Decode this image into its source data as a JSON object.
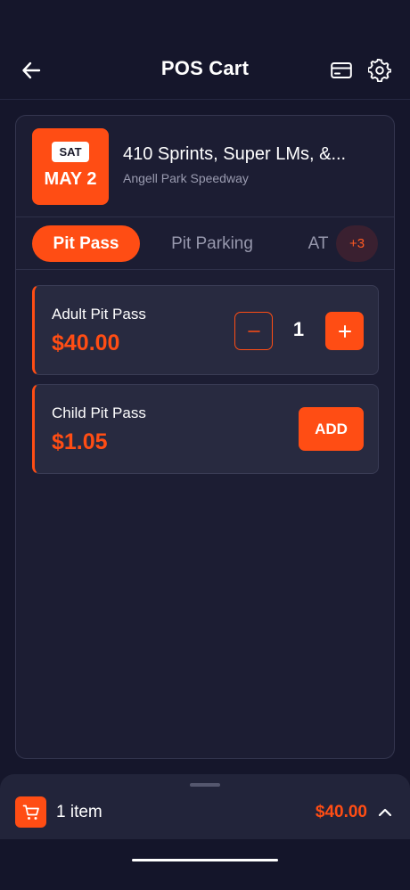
{
  "header": {
    "title": "POS Cart",
    "back_icon": "arrow-left-icon",
    "card_icon": "credit-card-icon",
    "settings_icon": "gear-icon"
  },
  "event": {
    "day": "SAT",
    "date": "MAY 2",
    "title": "410 Sprints, Super LMs, &...",
    "venue": "Angell Park Speedway"
  },
  "tabs": {
    "items": [
      {
        "label": "Pit Pass",
        "active": true
      },
      {
        "label": "Pit Parking",
        "active": false
      },
      {
        "label": "AT",
        "active": false
      }
    ],
    "more_label": "+3"
  },
  "tickets": [
    {
      "name": "Adult Pit Pass",
      "price": "$40.00",
      "quantity": "1"
    },
    {
      "name": "Child Pit Pass",
      "price": "$1.05",
      "add_label": "ADD"
    }
  ],
  "cart": {
    "count_label": "1 item",
    "total": "$40.00"
  },
  "colors": {
    "accent": "#ff4d14",
    "background": "#15162b",
    "panel": "#1c1d33",
    "card": "#282a40",
    "muted_text": "#9697ac"
  }
}
